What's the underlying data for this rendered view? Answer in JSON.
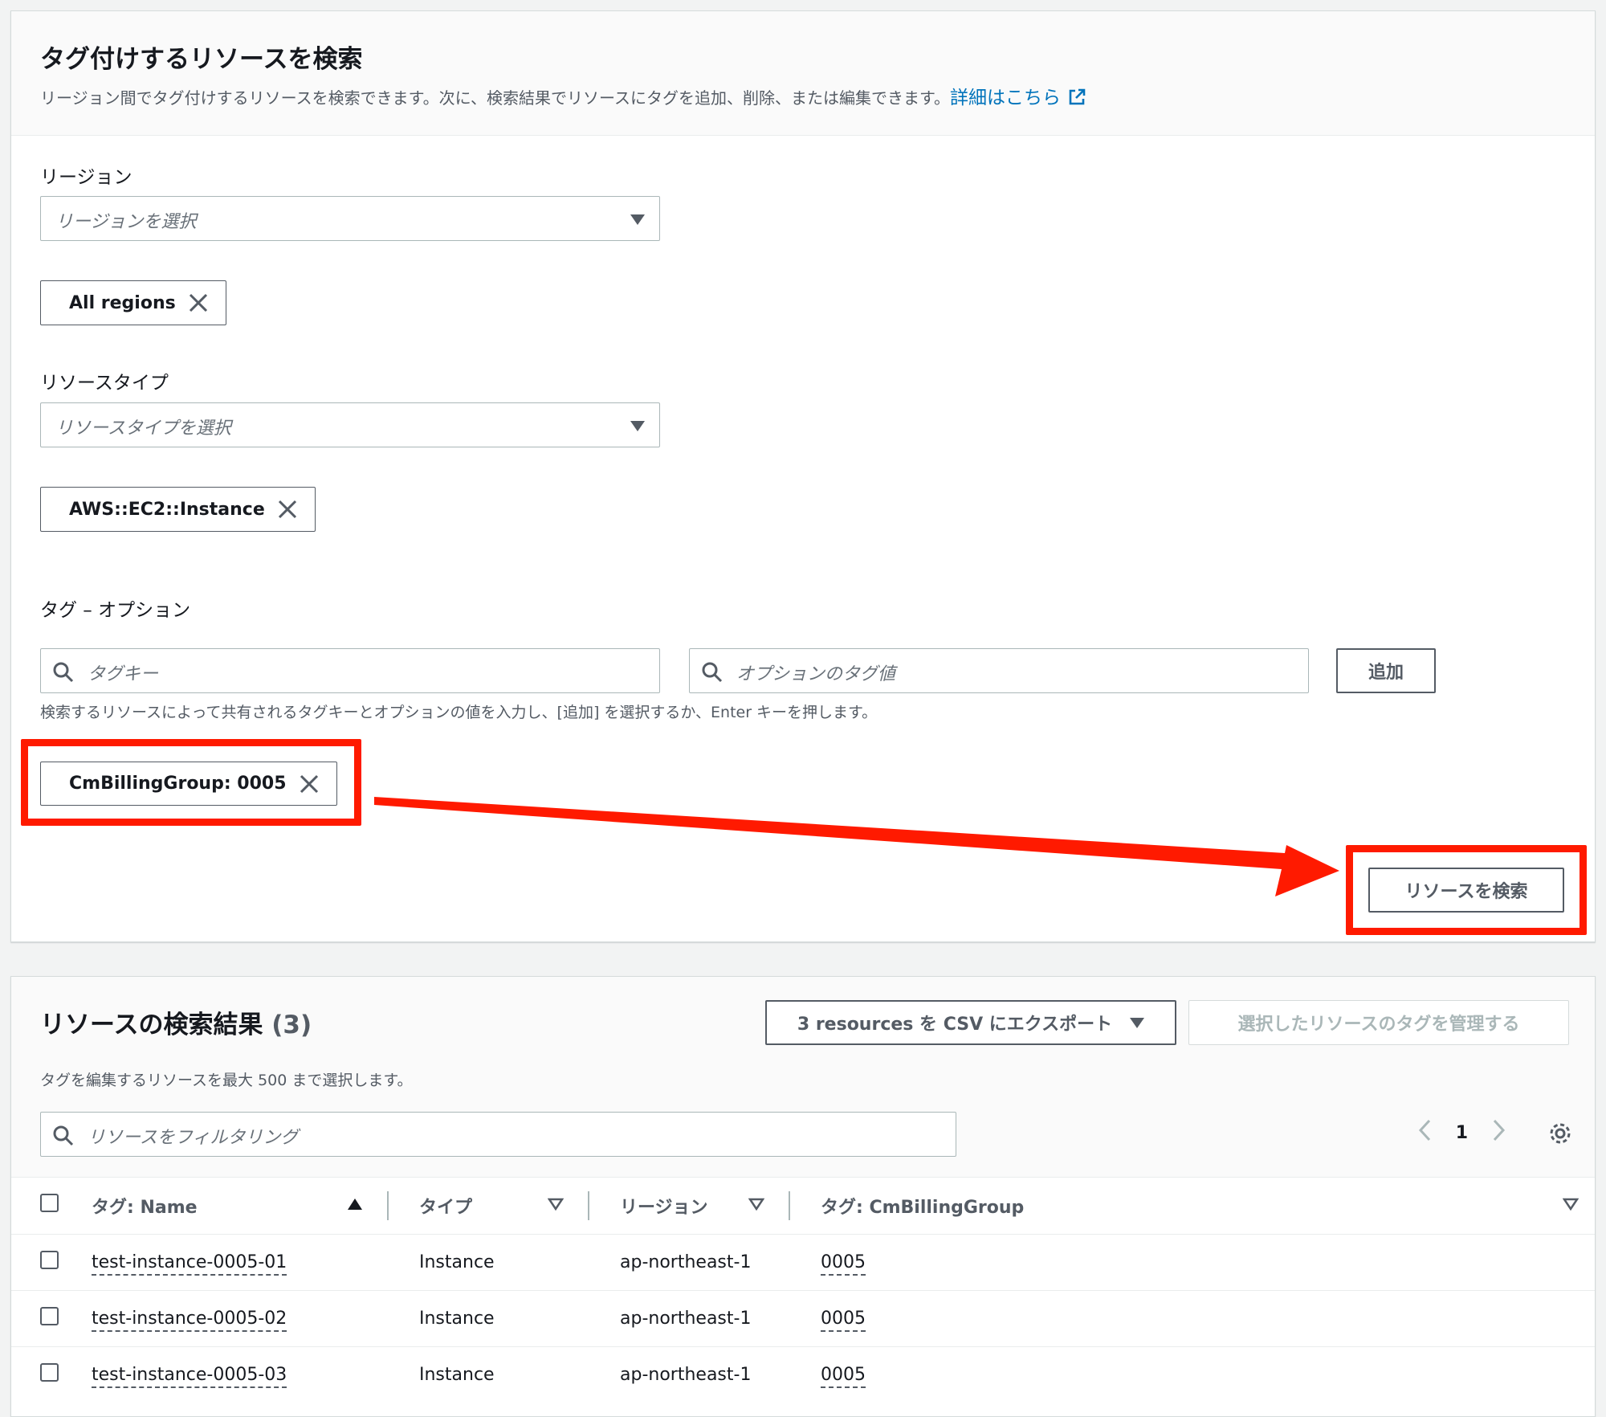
{
  "search_panel": {
    "title": "タグ付けするリソースを検索",
    "description": "リージョン間でタグ付けするリソースを検索できます。次に、検索結果でリソースにタグを追加、削除、または編集できます。",
    "learn_more_link": "詳細はこちら",
    "region": {
      "label": "リージョン",
      "placeholder": "リージョンを選択",
      "token": "All regions"
    },
    "resource_type": {
      "label": "リソースタイプ",
      "placeholder": "リソースタイプを選択",
      "token": "AWS::EC2::Instance"
    },
    "tags": {
      "label": "タグ – オプション",
      "key_placeholder": "タグキー",
      "value_placeholder": "オプションのタグ値",
      "add_button": "追加",
      "hint": "検索するリソースによって共有されるタグキーとオプションの値を入力し、[追加] を選択するか、Enter キーを押します。",
      "token": "CmBillingGroup: 0005"
    },
    "search_button": "リソースを検索"
  },
  "results_panel": {
    "title": "リソースの検索結果",
    "count": "(3)",
    "export_button": "3 resources を CSV にエクスポート",
    "manage_tags_button": "選択したリソースのタグを管理する",
    "description": "タグを編集するリソースを最大 500 まで選択します。",
    "filter_placeholder": "リソースをフィルタリング",
    "page": "1",
    "columns": [
      "タグ: Name",
      "タイプ",
      "リージョン",
      "タグ: CmBillingGroup"
    ],
    "rows": [
      {
        "name": "test-instance-0005-01",
        "type": "Instance",
        "region": "ap-northeast-1",
        "billing": "0005"
      },
      {
        "name": "test-instance-0005-02",
        "type": "Instance",
        "region": "ap-northeast-1",
        "billing": "0005"
      },
      {
        "name": "test-instance-0005-03",
        "type": "Instance",
        "region": "ap-northeast-1",
        "billing": "0005"
      }
    ]
  },
  "colors": {
    "annotation_red": "#ff1a00",
    "link_blue": "#0073bb"
  }
}
